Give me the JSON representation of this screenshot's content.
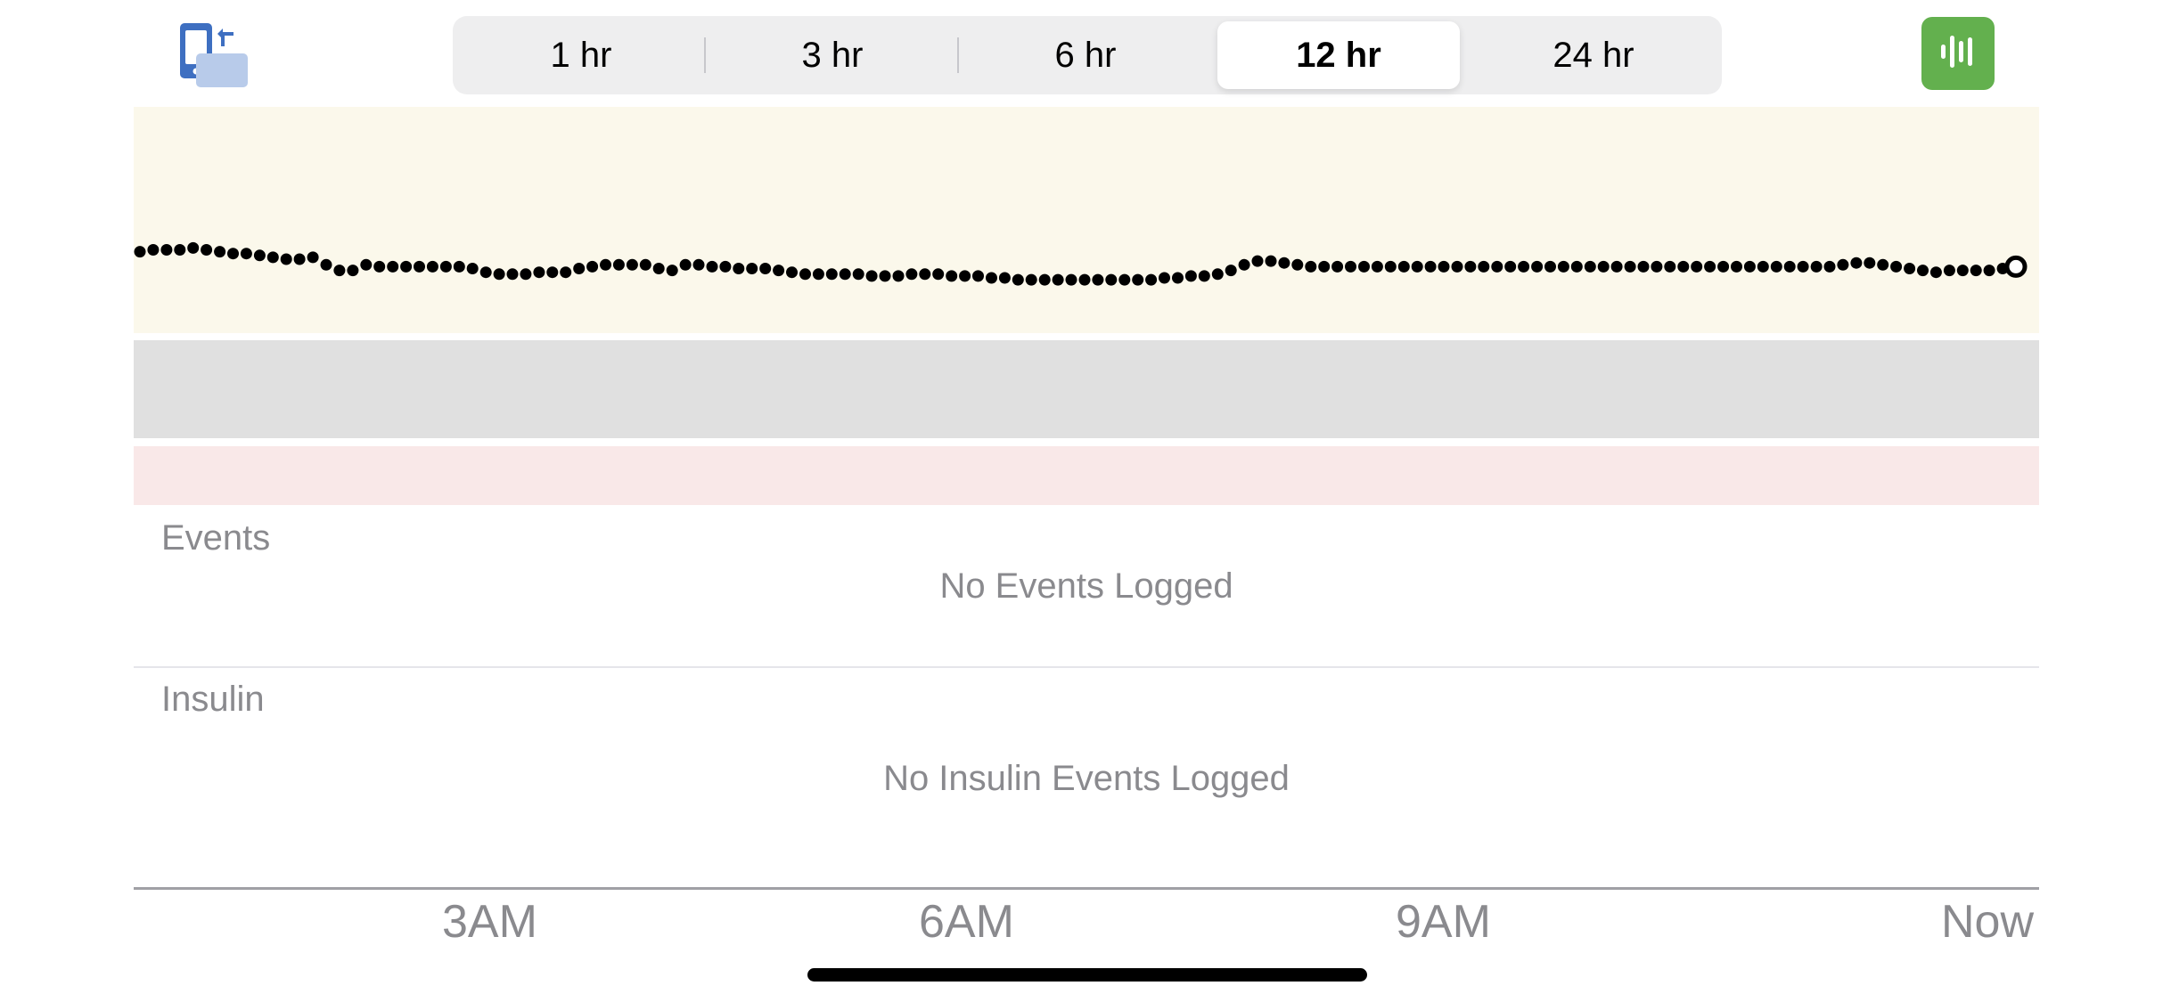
{
  "icons": {
    "rotate": "rotate-device-icon",
    "audio": "audio-waveform-icon"
  },
  "colors": {
    "accent_blue": "#3e6fc1",
    "accent_green": "#63b04e",
    "band_high": "#fbf8eb",
    "band_range": "#e0e0e0",
    "band_low": "#f9e8e8",
    "segment_bg": "#eeeeef",
    "secondary_text": "#8a8a8e"
  },
  "time_range": {
    "options": [
      "1 hr",
      "3 hr",
      "6 hr",
      "12 hr",
      "24 hr"
    ],
    "selected": "12 hr"
  },
  "sections": {
    "events": {
      "title": "Events",
      "empty_message": "No Events Logged"
    },
    "insulin": {
      "title": "Insulin",
      "empty_message": "No Insulin Events Logged"
    }
  },
  "chart_data": {
    "type": "scatter",
    "series": [
      {
        "values": [
          94,
          95,
          95,
          95,
          96,
          95,
          94,
          93,
          93,
          92,
          91,
          90,
          90,
          91,
          87,
          84,
          84,
          87,
          86,
          86,
          86,
          86,
          86,
          86,
          86,
          85,
          83,
          82,
          82,
          82,
          83,
          83,
          83,
          85,
          86,
          87,
          87,
          87,
          87,
          85,
          84,
          87,
          87,
          86,
          86,
          85,
          85,
          85,
          84,
          83,
          82,
          82,
          82,
          82,
          82,
          81,
          81,
          81,
          82,
          82,
          82,
          81,
          81,
          81,
          80,
          80,
          79,
          79,
          79,
          79,
          79,
          79,
          79,
          79,
          79,
          79,
          79,
          80,
          80,
          81,
          81,
          82,
          84,
          87,
          89,
          89,
          88,
          87,
          86,
          86,
          86,
          86,
          86,
          86,
          86,
          86,
          86,
          86,
          86,
          86,
          86,
          86,
          86,
          86,
          86,
          86,
          86,
          86,
          86,
          86,
          86,
          86,
          86,
          86,
          86,
          86,
          86,
          86,
          86,
          86,
          86,
          86,
          86,
          86,
          86,
          86,
          86,
          86,
          87,
          88,
          88,
          87,
          86,
          85,
          84,
          83,
          84,
          84,
          84,
          84,
          85,
          86
        ]
      }
    ],
    "x_tick_labels": [
      "3AM",
      "6AM",
      "9AM",
      "Now"
    ],
    "bands": [
      {
        "name": "high",
        "color": "#fbf8eb"
      },
      {
        "name": "in-range",
        "color": "#e0e0e0"
      },
      {
        "name": "low",
        "color": "#f9e8e8"
      }
    ],
    "latest_point_style": "hollow",
    "grid": false
  }
}
